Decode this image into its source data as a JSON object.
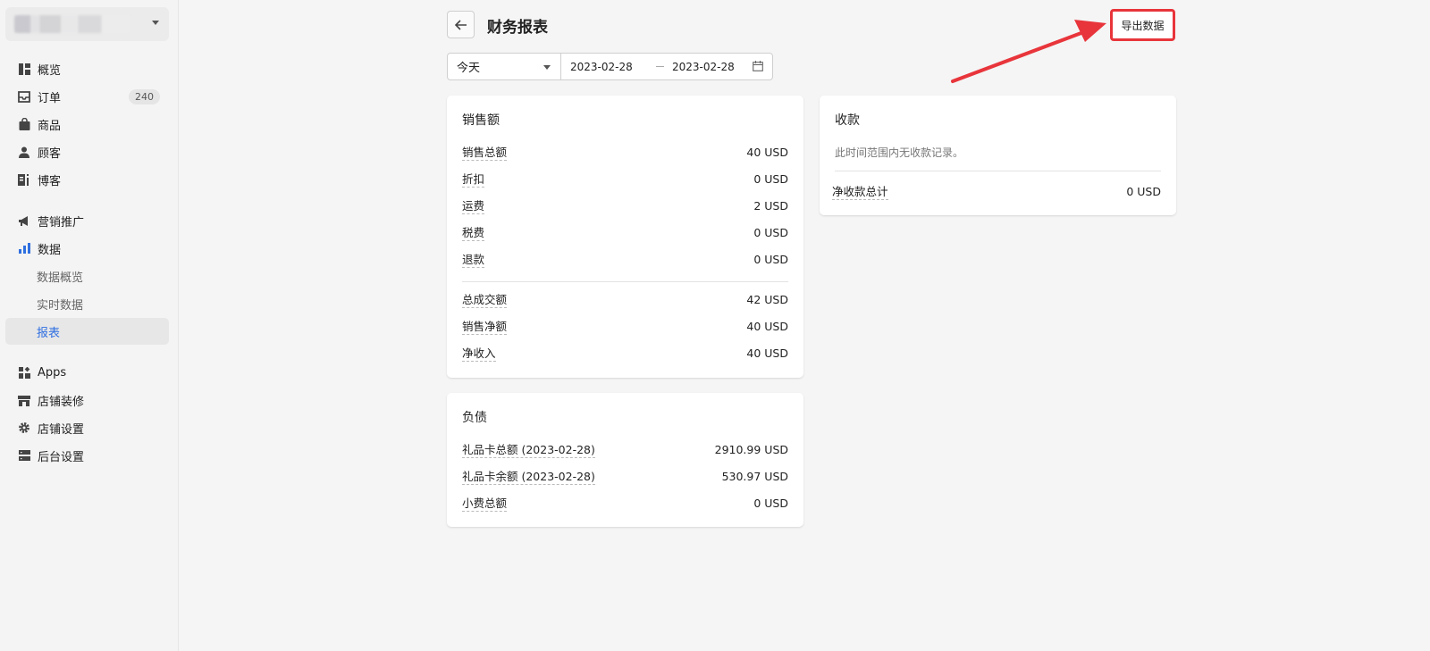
{
  "sidebar": {
    "items": [
      {
        "label": "概览",
        "icon": "dashboard-icon"
      },
      {
        "label": "订单",
        "icon": "inbox-icon",
        "badge": "240"
      },
      {
        "label": "商品",
        "icon": "bag-icon"
      },
      {
        "label": "顾客",
        "icon": "person-icon"
      },
      {
        "label": "博客",
        "icon": "blog-icon"
      },
      {
        "label": "营销推广",
        "icon": "megaphone-icon"
      },
      {
        "label": "数据",
        "icon": "bar-chart-icon"
      },
      {
        "label": "数据概览"
      },
      {
        "label": "实时数据"
      },
      {
        "label": "报表"
      },
      {
        "label": "Apps",
        "icon": "apps-icon"
      },
      {
        "label": "店铺装修",
        "icon": "storefront-icon"
      },
      {
        "label": "店铺设置",
        "icon": "gear-icon"
      },
      {
        "label": "后台设置",
        "icon": "server-icon"
      }
    ]
  },
  "header": {
    "title": "财务报表",
    "export_label": "导出数据"
  },
  "filters": {
    "period": "今天",
    "start_date": "2023-02-28",
    "end_date": "2023-02-28"
  },
  "sales": {
    "title": "销售额",
    "rows": [
      {
        "label": "销售总额",
        "value": "40 USD"
      },
      {
        "label": "折扣",
        "value": "0 USD"
      },
      {
        "label": "运费",
        "value": "2 USD"
      },
      {
        "label": "税费",
        "value": "0 USD"
      },
      {
        "label": "退款",
        "value": "0 USD"
      },
      {
        "label": "总成交额",
        "value": "42 USD"
      },
      {
        "label": "销售净额",
        "value": "40 USD"
      },
      {
        "label": "净收入",
        "value": "40 USD"
      }
    ]
  },
  "liabilities": {
    "title": "负债",
    "rows": [
      {
        "label": "礼品卡总额 (2023-02-28)",
        "value": "2910.99 USD"
      },
      {
        "label": "礼品卡余额 (2023-02-28)",
        "value": "530.97 USD"
      },
      {
        "label": "小费总额",
        "value": "0 USD"
      }
    ]
  },
  "payments": {
    "title": "收款",
    "empty_note": "此时间范围内无收款记录。",
    "total_label": "净收款总计",
    "total_value": "0 USD"
  },
  "colors": {
    "accent": "#2f6fe0",
    "annotation_red": "#e8353b"
  }
}
